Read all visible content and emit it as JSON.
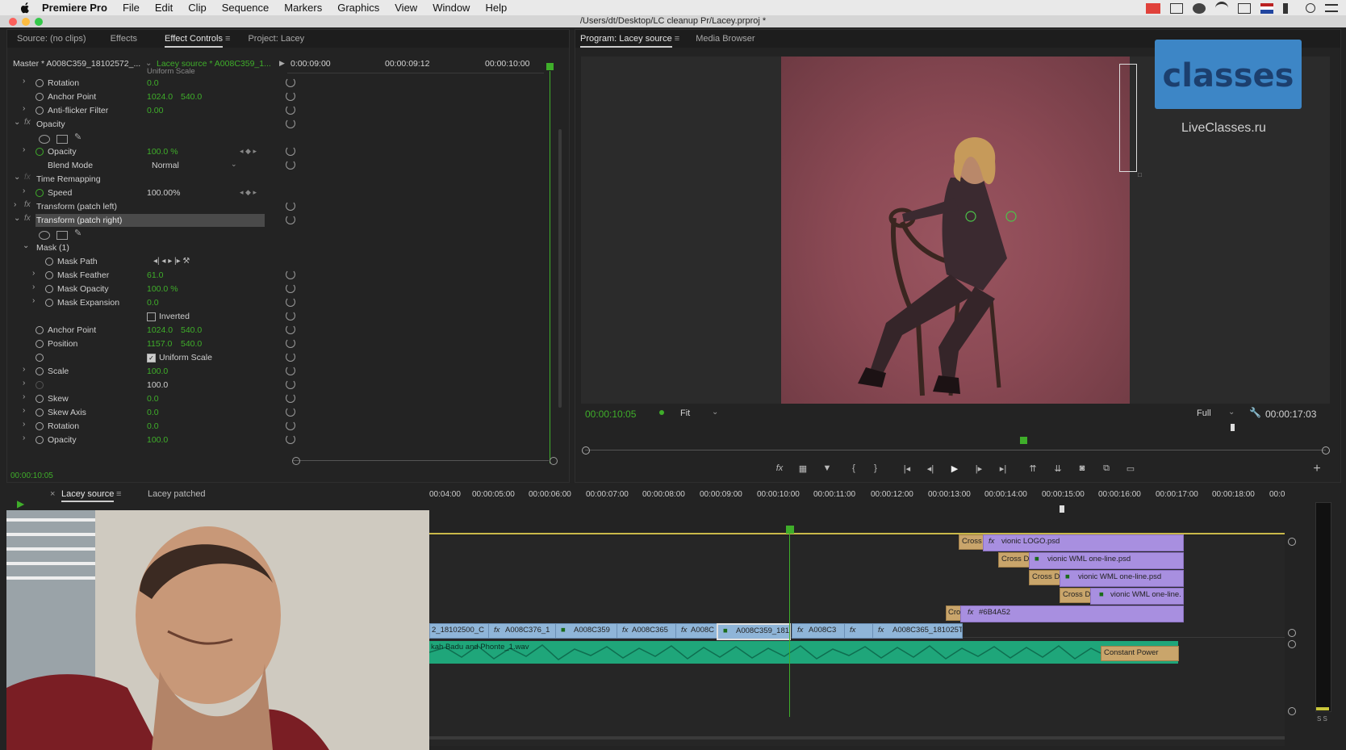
{
  "menubar": {
    "app": "Premiere Pro",
    "items": [
      "File",
      "Edit",
      "Clip",
      "Sequence",
      "Markers",
      "Graphics",
      "View",
      "Window",
      "Help"
    ]
  },
  "window_title": "/Users/dt/Desktop/LC cleanup Pr/Lacey.prproj *",
  "left_panel": {
    "tabs": [
      "Source: (no clips)",
      "Effects",
      "Effect Controls",
      "Project: Lacey"
    ],
    "active_tab": "Effect Controls",
    "master_label": "Master * A008C359_18102572_...",
    "source_label": "Lacey source * A008C359_1...",
    "ruler": [
      "0:00:09:00",
      "00:00:09:12",
      "00:00:10:00"
    ],
    "partial_row": "Uniform Scale",
    "rows": [
      {
        "label": "Rotation",
        "value": "0.0"
      },
      {
        "label": "Anchor Point",
        "value": "1024.0",
        "value2": "540.0"
      },
      {
        "label": "Anti-flicker Filter",
        "value": "0.00"
      },
      {
        "label": "Opacity"
      },
      {
        "label": "Opacity",
        "value": "100.0 %"
      },
      {
        "label": "Blend Mode",
        "value": "Normal"
      },
      {
        "label": "Time Remapping"
      },
      {
        "label": "Speed",
        "value": "100.00%"
      },
      {
        "label": "Transform (patch left)"
      },
      {
        "label": "Transform (patch right)"
      },
      {
        "label": "Mask (1)"
      },
      {
        "label": "Mask Path"
      },
      {
        "label": "Mask Feather",
        "value": "61.0"
      },
      {
        "label": "Mask Opacity",
        "value": "100.0 %"
      },
      {
        "label": "Mask Expansion",
        "value": "0.0"
      },
      {
        "label": "Inverted"
      },
      {
        "label": "Anchor Point",
        "value": "1024.0",
        "value2": "540.0"
      },
      {
        "label": "Position",
        "value": "1157.0",
        "value2": "540.0"
      },
      {
        "label": "Uniform Scale"
      },
      {
        "label": "Scale",
        "value": "100.0"
      },
      {
        "label": "",
        "value": "100.0"
      },
      {
        "label": "Skew",
        "value": "0.0"
      },
      {
        "label": "Skew Axis",
        "value": "0.0"
      },
      {
        "label": "Rotation",
        "value": "0.0"
      },
      {
        "label": "Opacity",
        "value": "100.0"
      }
    ],
    "current_time": "00:00:10:05"
  },
  "program_monitor": {
    "tabs": [
      "Program: Lacey source",
      "Media Browser"
    ],
    "active_tab": "Program: Lacey source",
    "timecode": "00:00:10:05",
    "fit": "Fit",
    "quality": "Full",
    "duration": "00:00:17:03",
    "watermark_text": "classes",
    "watermark_sub": "LiveClasses.ru"
  },
  "timeline": {
    "tabs": [
      "Lacey source",
      "Lacey patched"
    ],
    "active_tab": "Lacey source",
    "ruler": [
      "00:04:00",
      "00:00:05:00",
      "00:00:06:00",
      "00:00:07:00",
      "00:00:08:00",
      "00:00:09:00",
      "00:00:10:00",
      "00:00:11:00",
      "00:00:12:00",
      "00:00:13:00",
      "00:00:14:00",
      "00:00:15:00",
      "00:00:16:00",
      "00:00:17:00",
      "00:00:18:00",
      "00:0"
    ],
    "clips": {
      "v5_trans": "Cross",
      "v5": "vionic LOGO.psd",
      "v4_trans": "Cross Di",
      "v4": "vionic WML one-line.psd",
      "v3_trans": "Cross Di",
      "v3": "vionic WML one-line.psd",
      "v2_trans": "Cross Di",
      "v2": "vionic WML one-line.",
      "v1b_trans": "Cro",
      "v1b": "#6B4A52",
      "v1": [
        "2_18102500_C",
        "A008C376_1",
        "A008C359",
        "A008C365",
        "A008C",
        "A008C359_181",
        "A008C3",
        "",
        "A008C365_181025T"
      ],
      "a1": "kah Badu and Phonte_1.wav",
      "a1_trans": "Constant Power"
    },
    "meter_label": "S S"
  },
  "colors": {
    "accent_green": "#3fae2a",
    "clip_purple": "#a88fe0",
    "clip_blue": "#8fb5d8",
    "audio_green": "#1fa67a",
    "backdrop": "#8c4a55"
  }
}
